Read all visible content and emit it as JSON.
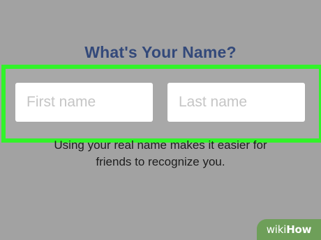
{
  "screen": {
    "title": "What's Your Name?",
    "fields": {
      "first_name_placeholder": "First name",
      "last_name_placeholder": "Last name"
    },
    "helper_line1": "Using your real name makes it easier for",
    "helper_line2": "friends to recognize you."
  },
  "watermark": {
    "text_a": "wiki",
    "text_b": "How"
  },
  "colors": {
    "background": "#a2a2a2",
    "title": "#33497a",
    "highlight": "#32f32a"
  }
}
